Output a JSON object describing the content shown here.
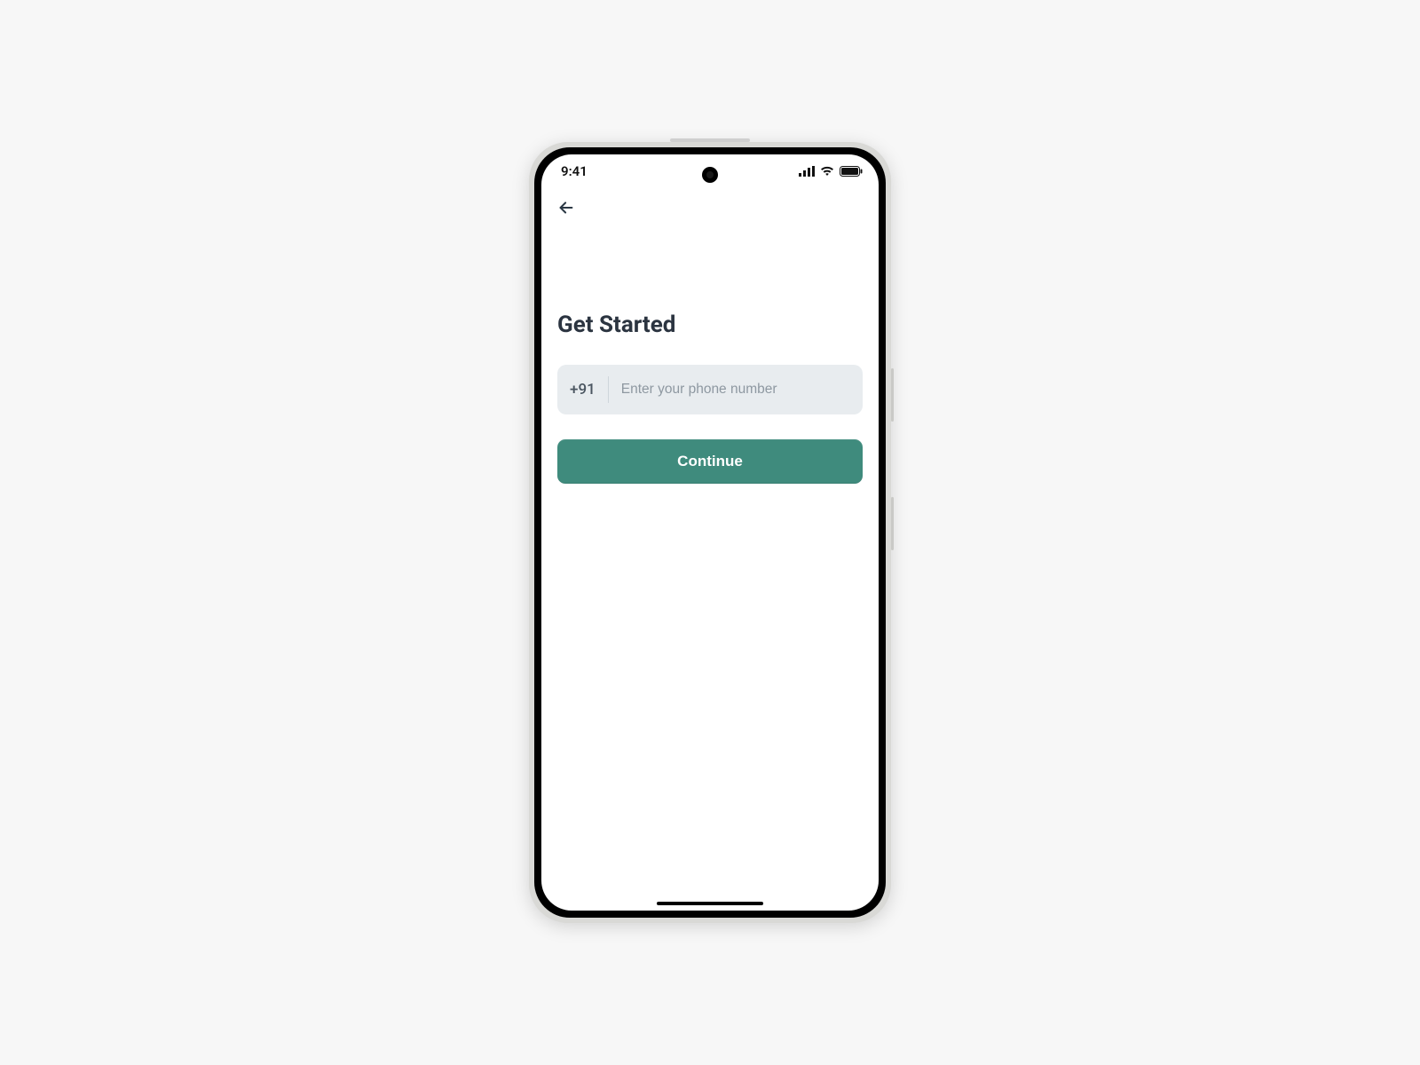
{
  "status_bar": {
    "time": "9:41"
  },
  "nav": {
    "back_icon": "arrow-left"
  },
  "page": {
    "title": "Get Started",
    "country_code": "+91",
    "phone_placeholder": "Enter your phone number",
    "phone_value": "",
    "continue_label": "Continue"
  },
  "colors": {
    "primary": "#3f8b7d",
    "field_bg": "#e8ecef",
    "title_text": "#2b3440"
  }
}
